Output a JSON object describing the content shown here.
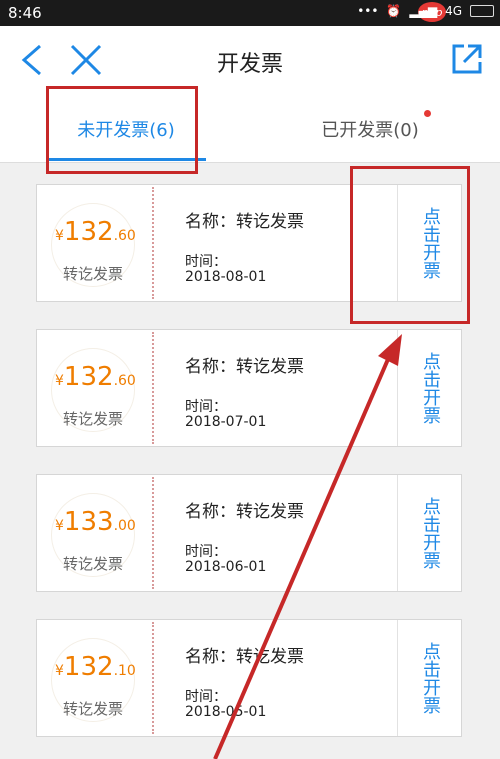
{
  "status_bar": {
    "time": "8:46",
    "network": "4G",
    "logo": "php"
  },
  "header": {
    "title": "开发票"
  },
  "tabs": [
    {
      "label": "未开发票(6)"
    },
    {
      "label": "已开发票(0)"
    }
  ],
  "invoices": [
    {
      "currency": "¥",
      "amount_int": "132",
      "amount_dec": ".60",
      "type_label": "转讫发票",
      "name": "名称：转讫发票",
      "time_label": "时间：",
      "date": "2018-08-01",
      "action": "点击开票"
    },
    {
      "currency": "¥",
      "amount_int": "132",
      "amount_dec": ".60",
      "type_label": "转讫发票",
      "name": "名称：转讫发票",
      "time_label": "时间：",
      "date": "2018-07-01",
      "action": "点击开票"
    },
    {
      "currency": "¥",
      "amount_int": "133",
      "amount_dec": ".00",
      "type_label": "转讫发票",
      "name": "名称：转讫发票",
      "time_label": "时间：",
      "date": "2018-06-01",
      "action": "点击开票"
    },
    {
      "currency": "¥",
      "amount_int": "132",
      "amount_dec": ".10",
      "type_label": "转讫发票",
      "name": "名称：转讫发票",
      "time_label": "时间：",
      "date": "2018-05-01",
      "action": "点击开票"
    }
  ],
  "colors": {
    "accent": "#1e88e5",
    "amount": "#ef7d00",
    "annotation": "#c62828"
  }
}
